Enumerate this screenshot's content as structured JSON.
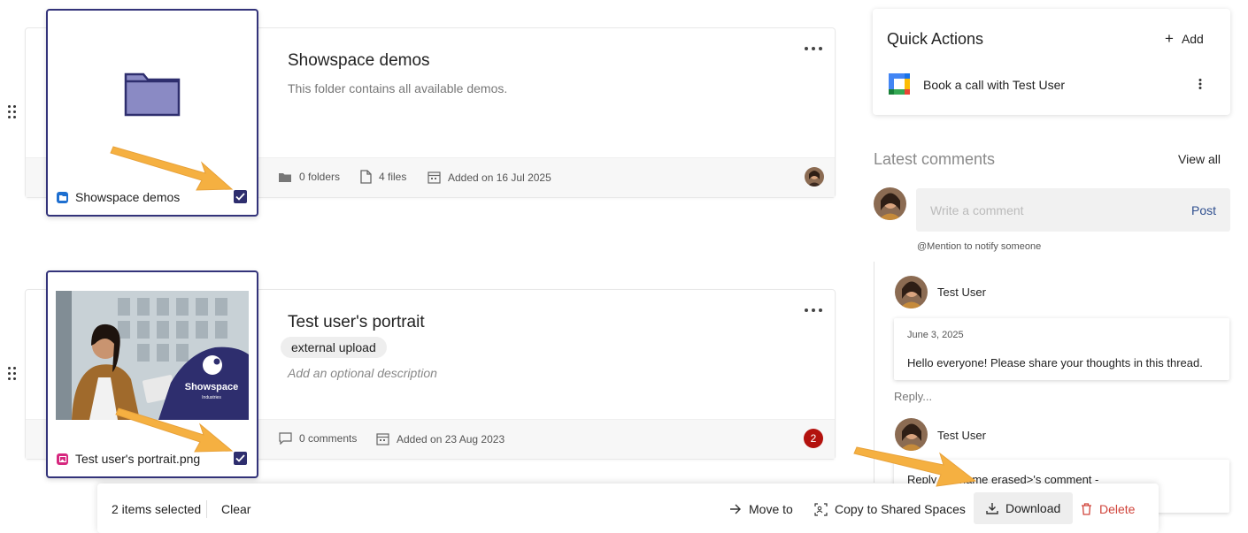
{
  "items": [
    {
      "title": "Showspace demos",
      "description": "This folder contains all available demos.",
      "meta": {
        "folders": "0 folders",
        "files": "4 files",
        "added": "Added on 16 Jul 2025"
      },
      "thumb_label": "Showspace demos"
    },
    {
      "title": "Test user's portrait",
      "tag": "external upload",
      "description_placeholder": "Add an optional description",
      "meta": {
        "comments": "0 comments",
        "added": "Added on 23 Aug 2023"
      },
      "thumb_label": "Test user's portrait.png",
      "notification_count": "2",
      "image_brand": "Showspace",
      "image_brand_sub": "Industries"
    }
  ],
  "quick_actions": {
    "title": "Quick Actions",
    "add_label": "Add",
    "items": [
      {
        "label": "Book a call with Test User"
      }
    ]
  },
  "comments": {
    "title": "Latest comments",
    "view_all": "View all",
    "input_placeholder": "Write a comment",
    "post_label": "Post",
    "mention_hint": "@Mention to notify someone",
    "thread": [
      {
        "author": "Test User",
        "date": "June 3, 2025",
        "text": "Hello everyone! Please share your thoughts in this thread."
      },
      {
        "author": "Test User",
        "text": "Reply to <name erased>'s comment -"
      }
    ],
    "reply_label": "Reply..."
  },
  "action_bar": {
    "selected_count": "2 items selected",
    "clear": "Clear",
    "move_to": "Move to",
    "copy_to": "Copy to Shared Spaces",
    "download": "Download",
    "delete": "Delete"
  },
  "colors": {
    "accent": "#2e2e6e",
    "folder": "#8a8ac4",
    "delete": "#d0433a",
    "annotation_arrow": "#f5b041",
    "badge": "#b3120e"
  }
}
